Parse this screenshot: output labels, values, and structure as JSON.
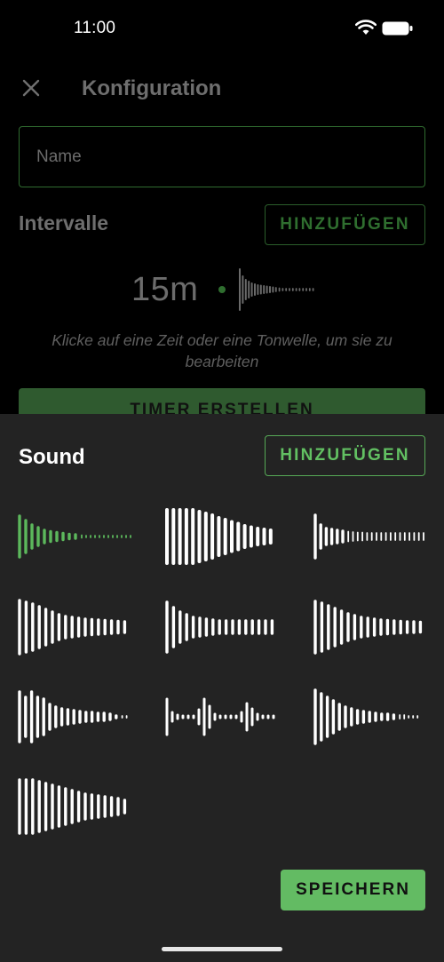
{
  "status": {
    "time": "11:00"
  },
  "config": {
    "title": "Konfiguration",
    "name_placeholder": "Name",
    "intervals_heading": "Intervalle",
    "add_label": "HINZUFÜGEN",
    "interval_time": "15m",
    "hint": "Klicke auf eine Zeit oder eine Tonwelle, um sie zu bearbeiten",
    "create_label": "TIMER ERSTELLEN"
  },
  "sheet": {
    "title": "Sound",
    "add_label": "HINZUFÜGEN",
    "save_label": "SPEICHERN",
    "sounds": [
      {
        "name": "sound-1",
        "selected": true
      },
      {
        "name": "sound-2",
        "selected": false
      },
      {
        "name": "sound-3",
        "selected": false
      },
      {
        "name": "sound-4",
        "selected": false
      },
      {
        "name": "sound-5",
        "selected": false
      },
      {
        "name": "sound-6",
        "selected": false
      },
      {
        "name": "sound-7",
        "selected": false
      },
      {
        "name": "sound-8",
        "selected": false
      },
      {
        "name": "sound-9",
        "selected": false
      },
      {
        "name": "sound-10",
        "selected": false
      }
    ]
  },
  "colors": {
    "accent": "#63bb63",
    "selected_wave": "#5cb85c",
    "wave": "#ffffff",
    "sheet_bg": "#232323"
  },
  "icons": [
    "wifi-icon",
    "battery-icon",
    "close-icon",
    "waveform-icon"
  ]
}
